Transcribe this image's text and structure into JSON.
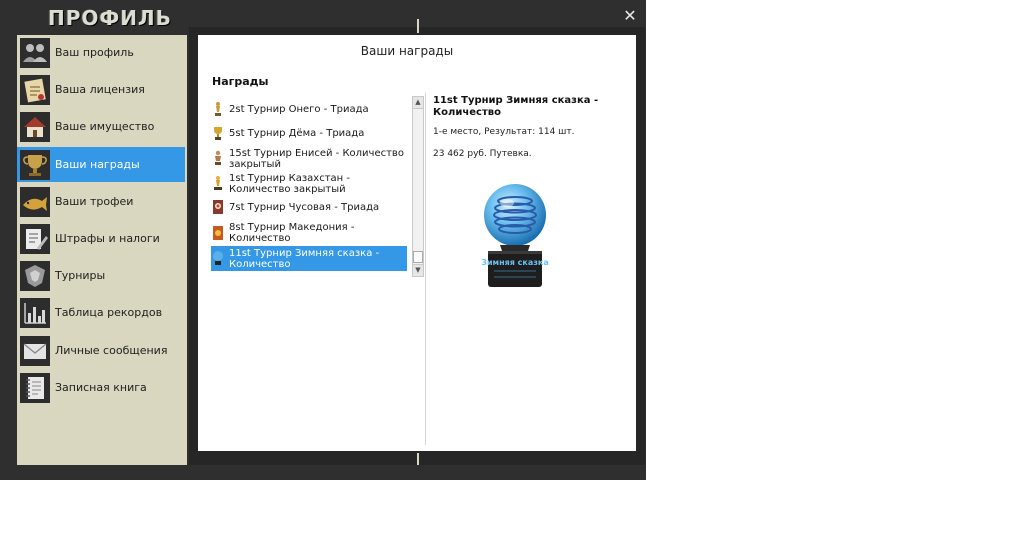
{
  "window": {
    "title": "ПРОФИЛЬ",
    "close_glyph": "✕"
  },
  "sidebar": {
    "items": [
      {
        "label": "Ваш профиль",
        "icon": "people-icon",
        "active": false
      },
      {
        "label": "Ваша лицензия",
        "icon": "license-icon",
        "active": false
      },
      {
        "label": "Ваше имущество",
        "icon": "house-icon",
        "active": false
      },
      {
        "label": "Ваши награды",
        "icon": "trophy-icon",
        "active": true
      },
      {
        "label": "Ваши трофеи",
        "icon": "fish-trophy-icon",
        "active": false
      },
      {
        "label": "Штрафы и налоги",
        "icon": "notepad-pen-icon",
        "active": false
      },
      {
        "label": "Турниры",
        "icon": "tournament-badge-icon",
        "active": false
      },
      {
        "label": "Таблица рекордов",
        "icon": "bar-chart-icon",
        "active": false
      },
      {
        "label": "Личные сообщения",
        "icon": "envelope-icon",
        "active": false
      },
      {
        "label": "Записная книга",
        "icon": "notebook-icon",
        "active": false
      }
    ],
    "active_color": "#3498e6"
  },
  "panel": {
    "title": "Ваши награды",
    "section_label": "Награды"
  },
  "awards": {
    "items": [
      {
        "label": "2st Турнир Онего - Триада",
        "icon": "silver-figure-award-icon",
        "selected": false
      },
      {
        "label": "5st Турнир Дёма - Триада",
        "icon": "gold-cup-award-icon",
        "selected": false
      },
      {
        "label": "15st Турнир Енисей - Количество закрытый",
        "icon": "figure-award-icon",
        "selected": false
      },
      {
        "label": "1st Турнир Казахстан - Количество закрытый",
        "icon": "gold-figure-award-icon",
        "selected": false
      },
      {
        "label": "7st Турнир Чусовая - Триада",
        "icon": "medal-award-icon",
        "selected": false
      },
      {
        "label": "8st Турнир Македония - Количество",
        "icon": "orange-medal-award-icon",
        "selected": false
      },
      {
        "label": "11st Турнир Зимняя сказка - Количество",
        "icon": "crystal-globe-award-icon",
        "selected": true
      }
    ]
  },
  "detail": {
    "title": "11st Турнир Зимняя сказка - Количество",
    "place": "1-е место, Результат: 114 шт.",
    "prize": "23 462 руб. Путевка.",
    "image_icon": "crystal-globe-trophy-icon",
    "plaque_text": "Зимняя сказка"
  }
}
